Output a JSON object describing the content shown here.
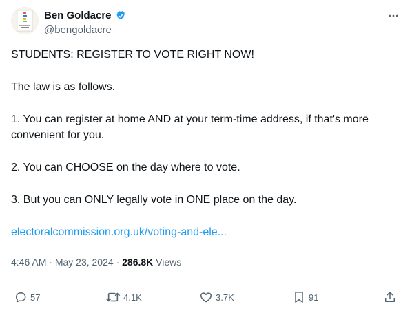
{
  "author": {
    "display_name": "Ben Goldacre",
    "handle": "@bengoldacre",
    "verified": true,
    "avatar_icon": "book-cover-avatar"
  },
  "tweet": {
    "paragraphs": [
      "STUDENTS: REGISTER TO VOTE RIGHT NOW!",
      "The law is as follows.",
      "1. You can register at home AND at your term-time address, if that's more convenient for you.",
      "2. You can CHOOSE on the day where to vote.",
      "3. But you can ONLY legally vote in ONE place on the day."
    ],
    "link_text": "electoralcommission.org.uk/voting-and-ele..."
  },
  "meta": {
    "time": "4:46 AM",
    "separator": "·",
    "date": "May 23, 2024",
    "views_count": "286.8K",
    "views_label": "Views"
  },
  "actions": {
    "replies": "57",
    "reposts": "4.1K",
    "likes": "3.7K",
    "bookmarks": "91"
  },
  "colors": {
    "link": "#1d9bf0",
    "verified": "#1d9bf0",
    "secondary_text": "#536471",
    "primary_text": "#0f1419"
  }
}
